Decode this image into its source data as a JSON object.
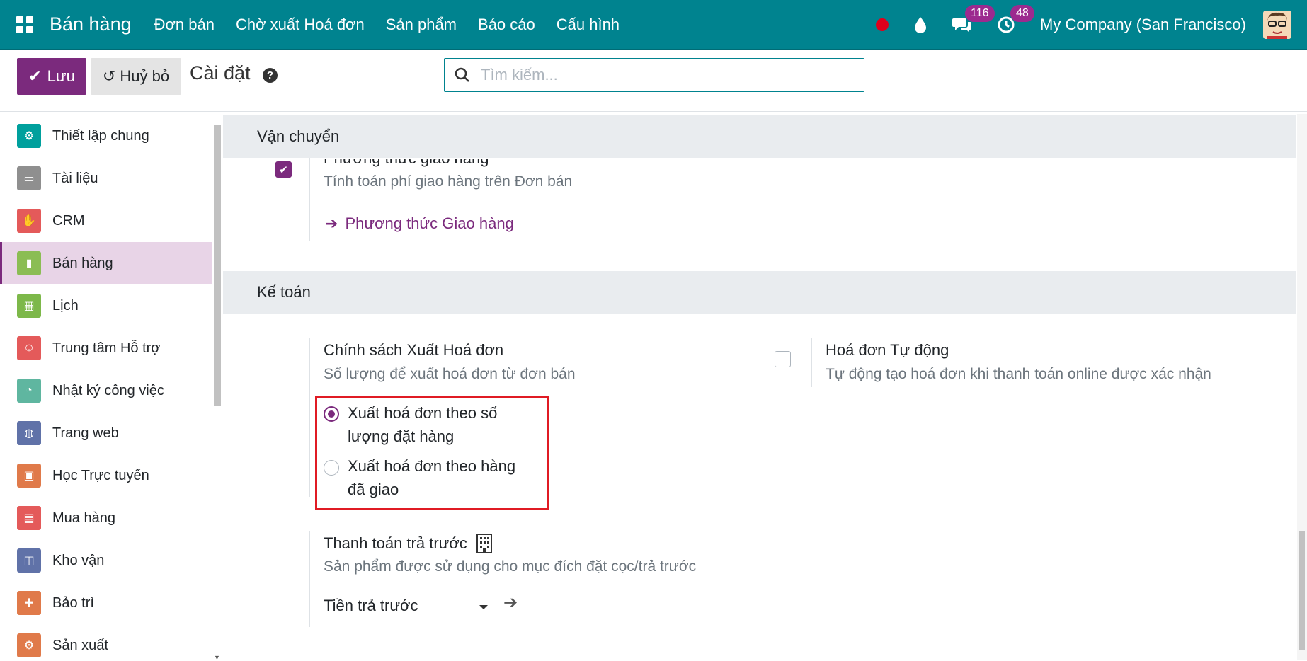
{
  "navbar": {
    "brand": "Bán hàng",
    "menu": [
      "Đơn bán",
      "Chờ xuất Hoá đơn",
      "Sản phẩm",
      "Báo cáo",
      "Cấu hình"
    ],
    "messages_count": "116",
    "activities_count": "48",
    "company": "My Company (San Francisco)",
    "accent_color": "#00838f"
  },
  "control": {
    "save_label": "Lưu",
    "discard_label": "Huỷ bỏ",
    "breadcrumb": "Cài đặt",
    "help_glyph": "?",
    "search_placeholder": "Tìm kiếm..."
  },
  "sidebar": {
    "items": [
      {
        "label": "Thiết lập chung",
        "icon": "gear-icon",
        "color": "#00a09d"
      },
      {
        "label": "Tài liệu",
        "icon": "folder-icon",
        "color": "#8f8f8f"
      },
      {
        "label": "CRM",
        "icon": "handshake-icon",
        "color": "#e45a5a"
      },
      {
        "label": "Bán hàng",
        "icon": "sales-chart-icon",
        "color": "#8bbd54"
      },
      {
        "label": "Lịch",
        "icon": "calendar-icon",
        "color": "#7db84a"
      },
      {
        "label": "Trung tâm Hỗ trợ",
        "icon": "helpdesk-icon",
        "color": "#e45a5a"
      },
      {
        "label": "Nhật ký công việc",
        "icon": "timesheet-icon",
        "color": "#5fb6a0"
      },
      {
        "label": "Trang web",
        "icon": "globe-icon",
        "color": "#6072a8"
      },
      {
        "label": "Học Trực tuyến",
        "icon": "elearning-icon",
        "color": "#e07a4a"
      },
      {
        "label": "Mua hàng",
        "icon": "purchase-icon",
        "color": "#e45a5a"
      },
      {
        "label": "Kho vận",
        "icon": "inventory-icon",
        "color": "#6072a8"
      },
      {
        "label": "Bảo trì",
        "icon": "maintenance-icon",
        "color": "#e07a4a"
      },
      {
        "label": "Sản xuất",
        "icon": "manufacturing-icon",
        "color": "#e07a4a"
      }
    ],
    "active_index": 3
  },
  "shipping": {
    "section_title": "Vận chuyển",
    "setting_title_partial": "Phương thức giao hàng",
    "setting_desc": "Tính toán phí giao hàng trên Đơn bán",
    "link_label": "Phương thức Giao hàng",
    "checked": true
  },
  "accounting": {
    "section_title": "Kế toán",
    "invoicing_policy": {
      "title": "Chính sách Xuất Hoá đơn",
      "desc": "Số lượng để xuất hoá đơn từ đơn bán",
      "options": [
        "Xuất hoá đơn theo số lượng đặt hàng",
        "Xuất hoá đơn theo hàng đã giao"
      ],
      "selected": 0
    },
    "auto_invoice": {
      "title": "Hoá đơn Tự động",
      "desc": "Tự động tạo hoá đơn khi thanh toán online được xác nhận",
      "checked": false
    },
    "down_payment": {
      "title": "Thanh toán trả trước",
      "desc": "Sản phẩm được sử dụng cho mục đích đặt cọc/trả trước",
      "product_value": "Tiền trả trước"
    }
  }
}
